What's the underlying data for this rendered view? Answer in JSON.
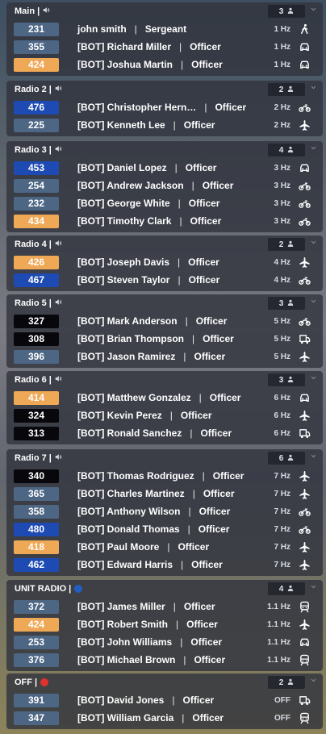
{
  "sections": [
    {
      "title": "Main",
      "sep": "|",
      "indicator": "speaker",
      "count": "3",
      "users": [
        {
          "id": "231",
          "badge": "gray",
          "name": "john smith",
          "rank": "Sergeant",
          "freq": "1 Hz",
          "icon": "person-walking-icon"
        },
        {
          "id": "355",
          "badge": "gray",
          "name": "[BOT] Richard Miller",
          "rank": "Officer",
          "freq": "1 Hz",
          "icon": "car-icon"
        },
        {
          "id": "424",
          "badge": "orange",
          "name": "[BOT] Joshua Martin",
          "rank": "Officer",
          "freq": "1 Hz",
          "icon": "car-icon"
        }
      ]
    },
    {
      "title": "Radio 2",
      "sep": "|",
      "indicator": "speaker",
      "count": "2",
      "users": [
        {
          "id": "476",
          "badge": "blue",
          "name": "[BOT] Christopher Hern…",
          "rank": "Officer",
          "freq": "2 Hz",
          "icon": "motorcycle-icon"
        },
        {
          "id": "225",
          "badge": "gray",
          "name": "[BOT] Kenneth Lee",
          "rank": "Officer",
          "freq": "2 Hz",
          "icon": "plane-icon"
        }
      ]
    },
    {
      "title": "Radio 3",
      "sep": "|",
      "indicator": "speaker",
      "count": "4",
      "users": [
        {
          "id": "453",
          "badge": "blue",
          "name": "[BOT] Daniel Lopez",
          "rank": "Officer",
          "freq": "3 Hz",
          "icon": "car-icon"
        },
        {
          "id": "254",
          "badge": "gray",
          "name": "[BOT] Andrew Jackson",
          "rank": "Officer",
          "freq": "3 Hz",
          "icon": "motorcycle-icon"
        },
        {
          "id": "232",
          "badge": "gray",
          "name": "[BOT] George White",
          "rank": "Officer",
          "freq": "3 Hz",
          "icon": "motorcycle-icon"
        },
        {
          "id": "434",
          "badge": "orange",
          "name": "[BOT] Timothy Clark",
          "rank": "Officer",
          "freq": "3 Hz",
          "icon": "motorcycle-icon"
        }
      ]
    },
    {
      "title": "Radio 4",
      "sep": "|",
      "indicator": "speaker",
      "count": "2",
      "users": [
        {
          "id": "426",
          "badge": "orange",
          "name": "[BOT] Joseph Davis",
          "rank": "Officer",
          "freq": "4 Hz",
          "icon": "plane-icon"
        },
        {
          "id": "467",
          "badge": "blue",
          "name": "[BOT] Steven Taylor",
          "rank": "Officer",
          "freq": "4 Hz",
          "icon": "motorcycle-icon"
        }
      ]
    },
    {
      "title": "Radio 5",
      "sep": "|",
      "indicator": "speaker",
      "count": "3",
      "users": [
        {
          "id": "327",
          "badge": "black",
          "name": "[BOT] Mark Anderson",
          "rank": "Officer",
          "freq": "5 Hz",
          "icon": "motorcycle-icon"
        },
        {
          "id": "308",
          "badge": "black",
          "name": "[BOT] Brian Thompson",
          "rank": "Officer",
          "freq": "5 Hz",
          "icon": "truck-icon"
        },
        {
          "id": "396",
          "badge": "gray",
          "name": "[BOT] Jason Ramirez",
          "rank": "Officer",
          "freq": "5 Hz",
          "icon": "plane-icon"
        }
      ]
    },
    {
      "title": "Radio 6",
      "sep": "|",
      "indicator": "speaker",
      "count": "3",
      "users": [
        {
          "id": "414",
          "badge": "orange",
          "name": "[BOT] Matthew Gonzalez",
          "rank": "Officer",
          "freq": "6 Hz",
          "icon": "car-icon"
        },
        {
          "id": "324",
          "badge": "black",
          "name": "[BOT] Kevin Perez",
          "rank": "Officer",
          "freq": "6 Hz",
          "icon": "plane-icon"
        },
        {
          "id": "313",
          "badge": "black",
          "name": "[BOT] Ronald Sanchez",
          "rank": "Officer",
          "freq": "6 Hz",
          "icon": "truck-icon"
        }
      ]
    },
    {
      "title": "Radio 7",
      "sep": "|",
      "indicator": "speaker",
      "count": "6",
      "users": [
        {
          "id": "340",
          "badge": "black",
          "name": "[BOT] Thomas Rodriguez",
          "rank": "Officer",
          "freq": "7 Hz",
          "icon": "plane-icon"
        },
        {
          "id": "365",
          "badge": "gray",
          "name": "[BOT] Charles Martinez",
          "rank": "Officer",
          "freq": "7 Hz",
          "icon": "plane-icon"
        },
        {
          "id": "358",
          "badge": "gray",
          "name": "[BOT] Anthony Wilson",
          "rank": "Officer",
          "freq": "7 Hz",
          "icon": "motorcycle-icon"
        },
        {
          "id": "480",
          "badge": "blue",
          "name": "[BOT] Donald Thomas",
          "rank": "Officer",
          "freq": "7 Hz",
          "icon": "motorcycle-icon"
        },
        {
          "id": "418",
          "badge": "orange",
          "name": "[BOT] Paul Moore",
          "rank": "Officer",
          "freq": "7 Hz",
          "icon": "plane-icon"
        },
        {
          "id": "462",
          "badge": "blue",
          "name": "[BOT] Edward Harris",
          "rank": "Officer",
          "freq": "7 Hz",
          "icon": "plane-icon"
        }
      ]
    },
    {
      "title": "UNIT RADIO",
      "sep": "|",
      "indicator": "blue-dot",
      "count": "4",
      "users": [
        {
          "id": "372",
          "badge": "gray",
          "name": "[BOT] James Miller",
          "rank": "Officer",
          "freq": "1.1 Hz",
          "icon": "train-icon"
        },
        {
          "id": "424",
          "badge": "orange",
          "name": "[BOT] Robert Smith",
          "rank": "Officer",
          "freq": "1.1 Hz",
          "icon": "plane-icon"
        },
        {
          "id": "253",
          "badge": "gray",
          "name": "[BOT] John Williams",
          "rank": "Officer",
          "freq": "1.1 Hz",
          "icon": "car-icon"
        },
        {
          "id": "376",
          "badge": "gray",
          "name": "[BOT] Michael Brown",
          "rank": "Officer",
          "freq": "1.1 Hz",
          "icon": "train-icon"
        }
      ]
    },
    {
      "title": "OFF",
      "sep": "|",
      "indicator": "red-dot",
      "count": "2",
      "users": [
        {
          "id": "391",
          "badge": "gray",
          "name": "[BOT] David Jones",
          "rank": "Officer",
          "freq": "OFF",
          "icon": "truck-icon"
        },
        {
          "id": "347",
          "badge": "gray",
          "name": "[BOT] William Garcia",
          "rank": "Officer",
          "freq": "OFF",
          "icon": "train-icon"
        }
      ]
    }
  ],
  "colors": {
    "badge_gray": "#4d6684",
    "badge_blue": "#1e4bb3",
    "badge_orange": "#efa855",
    "badge_black": "#08080c",
    "dot_blue": "#1f5fc2",
    "dot_red": "#e0322c"
  }
}
